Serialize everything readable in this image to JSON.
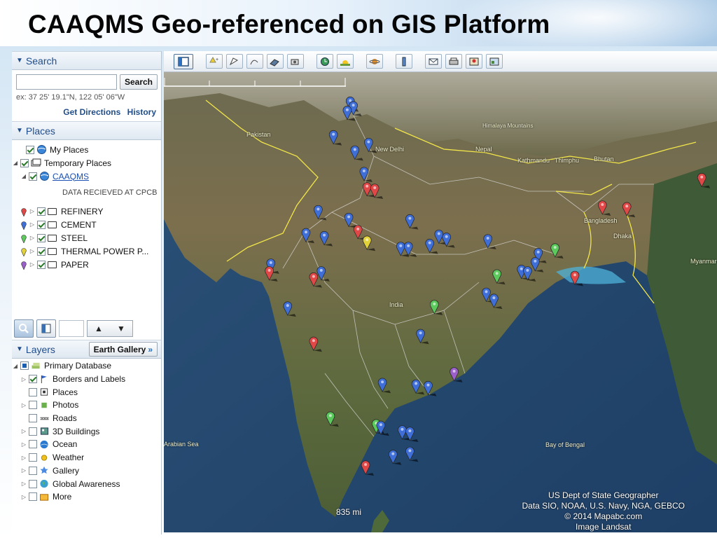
{
  "slide": {
    "title": "CAAQMS Geo-referenced on GIS Platform"
  },
  "search": {
    "header": "Search",
    "input_value": "",
    "button_label": "Search",
    "hint": "ex: 37 25' 19.1\"N, 122 05' 06\"W",
    "get_directions": "Get Directions",
    "history": "History"
  },
  "places": {
    "header": "Places",
    "my_places": "My Places",
    "temporary_places": "Temporary Places",
    "caaqms": "CAAQMS",
    "data_received": "DATA RECIEVED AT CPCB",
    "categories": [
      {
        "label": "REFINERY",
        "pin_color": "#e04848"
      },
      {
        "label": "CEMENT",
        "pin_color": "#3f6fd6"
      },
      {
        "label": "STEEL",
        "pin_color": "#5cc95c"
      },
      {
        "label": "THERMAL POWER P...",
        "pin_color": "#e2d23a"
      },
      {
        "label": "PAPER",
        "pin_color": "#9a5fc8"
      }
    ]
  },
  "layers": {
    "header": "Layers",
    "earth_gallery": "Earth Gallery",
    "items": [
      "Primary Database",
      "Borders and Labels",
      "Places",
      "Photos",
      "Roads",
      "3D Buildings",
      "Ocean",
      "Weather",
      "Gallery",
      "Global Awareness",
      "More"
    ]
  },
  "map": {
    "labels": [
      "Pakistan",
      "New Delhi",
      "Nepal",
      "Kathmandu",
      "Thimphu",
      "Bhutan",
      "Bangladesh",
      "Dhaka",
      "India",
      "Bay of Bengal",
      "Arabian Sea",
      "Myanmar",
      "Himalaya Mountains"
    ],
    "attribution": [
      "US Dept of State Geographer",
      "Data SIO, NOAA, U.S. Navy, NGA, GEBCO",
      "© 2014 Mapabc.com",
      "Image Landsat"
    ],
    "scale_label": "835 mi",
    "colors": {
      "refinery": "#e04848",
      "cement": "#3f6fd6",
      "steel": "#5cc95c",
      "thermal": "#e2d23a",
      "paper": "#9a5fc8"
    },
    "pins": [
      {
        "type": "cement",
        "lat": 34.5,
        "lon": 74.8
      },
      {
        "type": "cement",
        "lat": 34.2,
        "lon": 75.0
      },
      {
        "type": "cement",
        "lat": 33.9,
        "lon": 74.6
      },
      {
        "type": "cement",
        "lat": 32.3,
        "lon": 73.7
      },
      {
        "type": "cement",
        "lat": 31.8,
        "lon": 76.0
      },
      {
        "type": "cement",
        "lat": 31.3,
        "lon": 75.1
      },
      {
        "type": "cement",
        "lat": 29.9,
        "lon": 75.7
      },
      {
        "type": "refinery",
        "lat": 28.9,
        "lon": 75.9
      },
      {
        "type": "refinery",
        "lat": 28.8,
        "lon": 76.4
      },
      {
        "type": "cement",
        "lat": 27.4,
        "lon": 72.7
      },
      {
        "type": "cement",
        "lat": 26.9,
        "lon": 74.7
      },
      {
        "type": "cement",
        "lat": 26.8,
        "lon": 78.7
      },
      {
        "type": "refinery",
        "lat": 26.1,
        "lon": 75.3
      },
      {
        "type": "thermal",
        "lat": 25.4,
        "lon": 75.9
      },
      {
        "type": "cement",
        "lat": 25.9,
        "lon": 71.9
      },
      {
        "type": "cement",
        "lat": 25.7,
        "lon": 73.1
      },
      {
        "type": "cement",
        "lat": 25.0,
        "lon": 78.1
      },
      {
        "type": "cement",
        "lat": 25.0,
        "lon": 78.6
      },
      {
        "type": "cement",
        "lat": 25.2,
        "lon": 80.0
      },
      {
        "type": "cement",
        "lat": 25.8,
        "lon": 80.6
      },
      {
        "type": "cement",
        "lat": 25.6,
        "lon": 81.1
      },
      {
        "type": "cement",
        "lat": 25.5,
        "lon": 83.8
      },
      {
        "type": "cement",
        "lat": 23.9,
        "lon": 69.6
      },
      {
        "type": "refinery",
        "lat": 23.4,
        "lon": 69.5
      },
      {
        "type": "refinery",
        "lat": 23.0,
        "lon": 72.4
      },
      {
        "type": "cement",
        "lat": 23.4,
        "lon": 72.9
      },
      {
        "type": "cement",
        "lat": 21.1,
        "lon": 70.7
      },
      {
        "type": "cement",
        "lat": 24.6,
        "lon": 87.1
      },
      {
        "type": "cement",
        "lat": 24.0,
        "lon": 86.9
      },
      {
        "type": "cement",
        "lat": 23.5,
        "lon": 86.0
      },
      {
        "type": "steel",
        "lat": 24.9,
        "lon": 88.2
      },
      {
        "type": "cement",
        "lat": 23.4,
        "lon": 86.4
      },
      {
        "type": "steel",
        "lat": 23.2,
        "lon": 84.4
      },
      {
        "type": "cement",
        "lat": 22.0,
        "lon": 83.7
      },
      {
        "type": "cement",
        "lat": 21.6,
        "lon": 84.2
      },
      {
        "type": "steel",
        "lat": 21.2,
        "lon": 80.3
      },
      {
        "type": "refinery",
        "lat": 23.1,
        "lon": 89.5
      },
      {
        "type": "refinery",
        "lat": 27.7,
        "lon": 91.3
      },
      {
        "type": "refinery",
        "lat": 27.6,
        "lon": 92.9
      },
      {
        "type": "refinery",
        "lat": 29.5,
        "lon": 97.8
      },
      {
        "type": "cement",
        "lat": 19.3,
        "lon": 79.4
      },
      {
        "type": "refinery",
        "lat": 18.8,
        "lon": 72.4
      },
      {
        "type": "paper",
        "lat": 16.8,
        "lon": 81.6
      },
      {
        "type": "cement",
        "lat": 16.1,
        "lon": 76.9
      },
      {
        "type": "cement",
        "lat": 16.0,
        "lon": 79.1
      },
      {
        "type": "cement",
        "lat": 15.9,
        "lon": 79.9
      },
      {
        "type": "steel",
        "lat": 13.9,
        "lon": 73.5
      },
      {
        "type": "steel",
        "lat": 13.4,
        "lon": 76.5
      },
      {
        "type": "cement",
        "lat": 13.3,
        "lon": 76.8
      },
      {
        "type": "cement",
        "lat": 13.0,
        "lon": 78.2
      },
      {
        "type": "cement",
        "lat": 12.9,
        "lon": 78.7
      },
      {
        "type": "cement",
        "lat": 11.4,
        "lon": 77.6
      },
      {
        "type": "cement",
        "lat": 11.6,
        "lon": 78.7
      },
      {
        "type": "refinery",
        "lat": 10.7,
        "lon": 75.8
      }
    ]
  }
}
